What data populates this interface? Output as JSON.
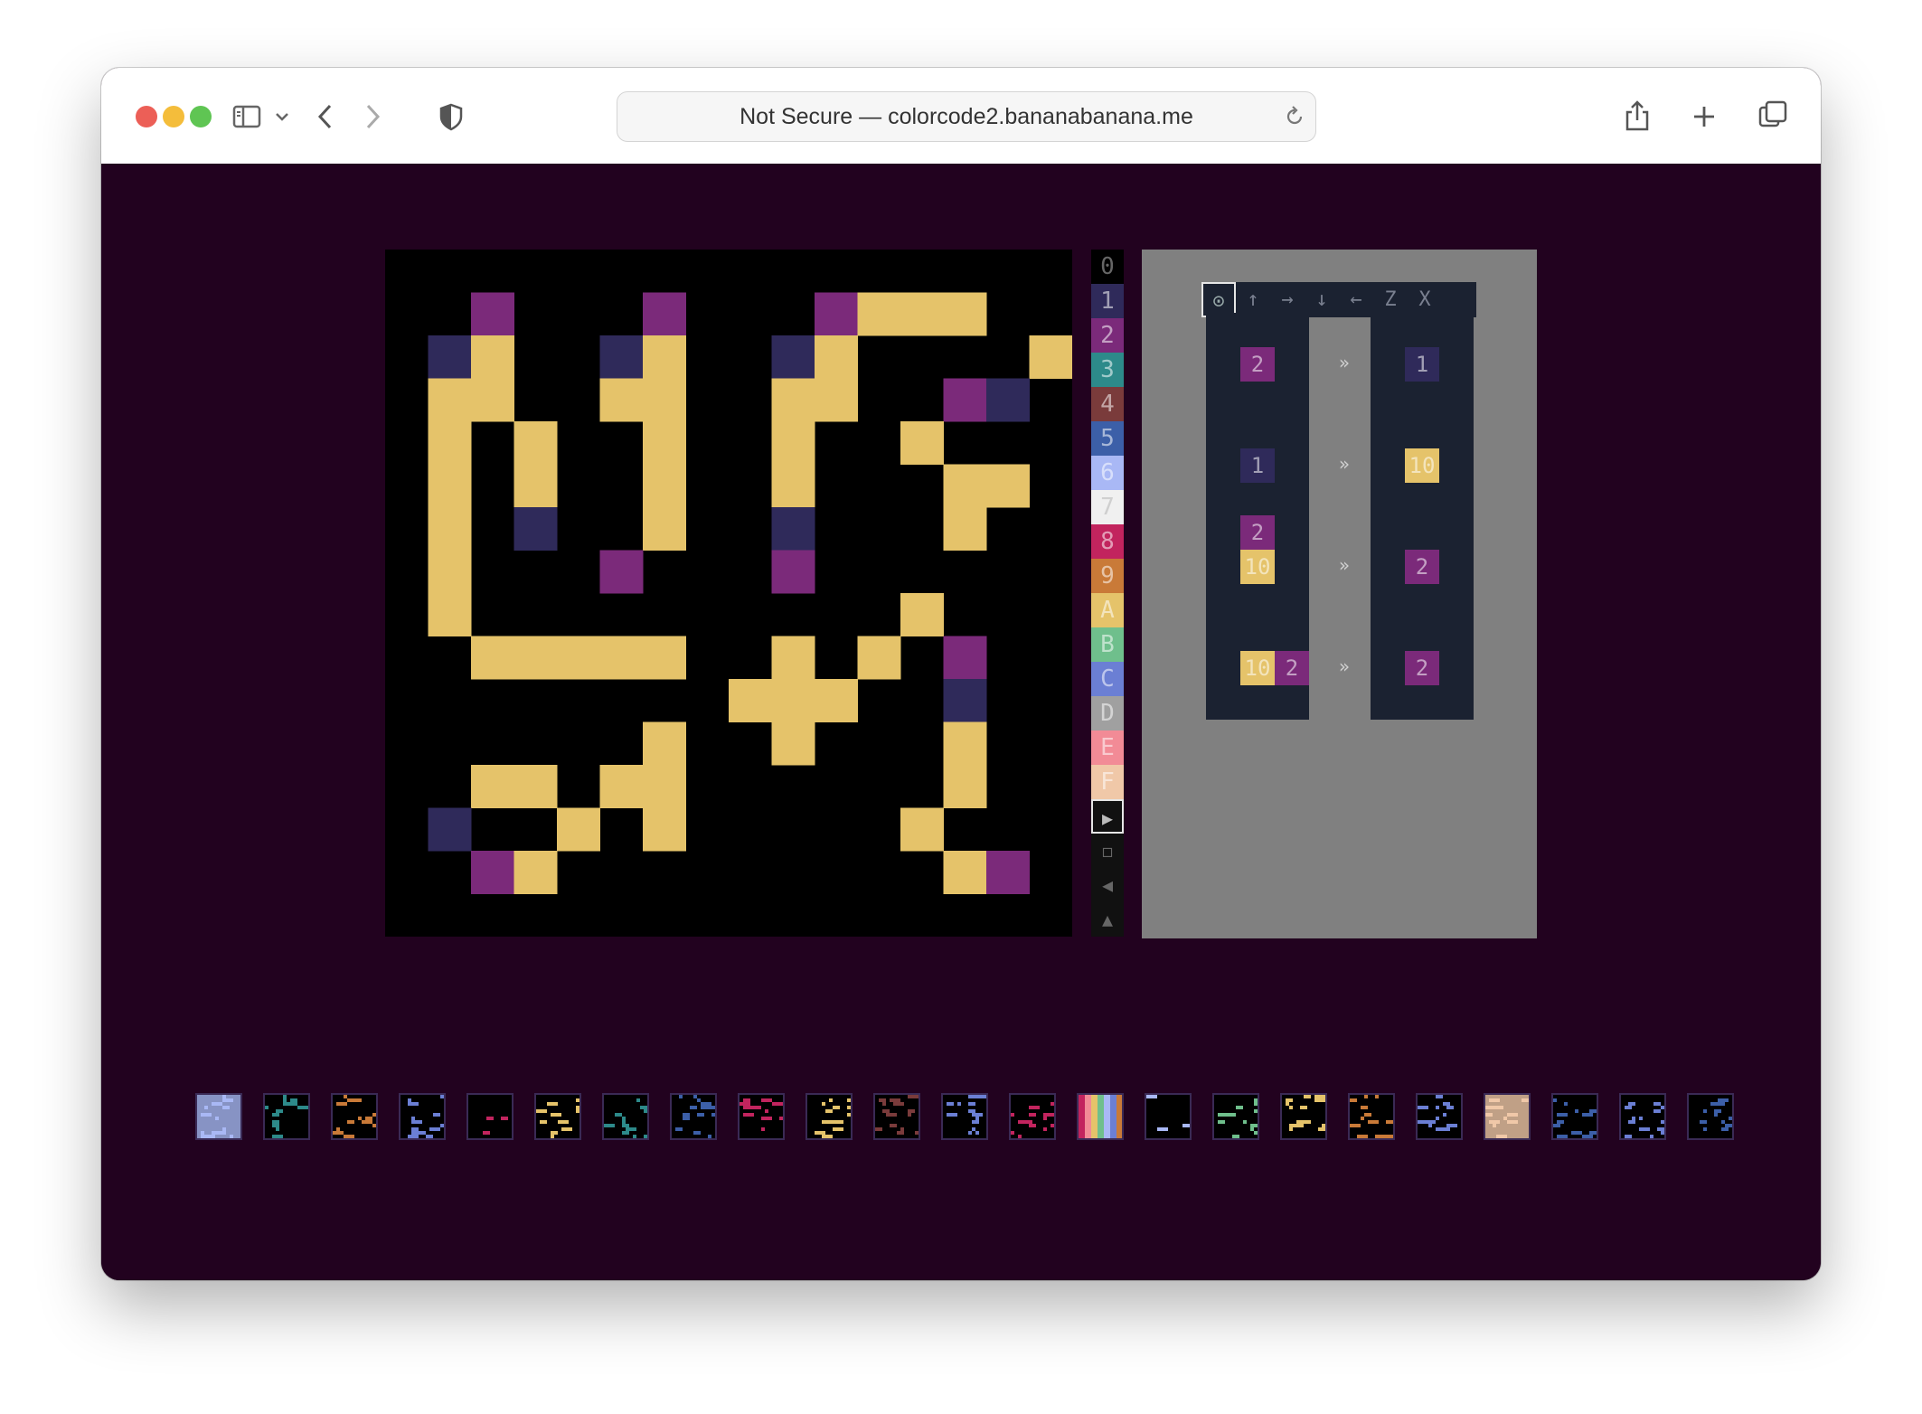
{
  "browser": {
    "url_text": "Not Secure — colorcode2.bananabanana.me"
  },
  "palette": {
    "labels": [
      "0",
      "1",
      "2",
      "3",
      "4",
      "5",
      "6",
      "7",
      "8",
      "9",
      "A",
      "B",
      "C",
      "D",
      "E",
      "F"
    ],
    "colors": [
      "#000000",
      "#2f2a5a",
      "#7b2a7a",
      "#2d8a8a",
      "#7a3b3b",
      "#3c5fa8",
      "#a9b8f5",
      "#f0f0f0",
      "#c2245e",
      "#c97a38",
      "#e5c36a",
      "#6fbf8c",
      "#6b7fd4",
      "#a0a0a0",
      "#f28b96",
      "#f0c8a8"
    ],
    "tools": [
      "▶",
      "◻",
      "◀",
      "▲"
    ]
  },
  "colors": {
    "yellow": "#e5c36a",
    "purple": "#7b2a7a",
    "navy": "#2f2a5a",
    "page_bg": "#22021f",
    "rules_bg": "#808080",
    "rule_box": "#1b2231"
  },
  "rules_toolbar": [
    "⊙",
    "↑",
    "→",
    "↓",
    "←",
    "Z",
    "X"
  ],
  "rules": [
    {
      "lhs": [
        "2"
      ],
      "rhs": [
        "1"
      ]
    },
    {
      "lhs": [
        "1"
      ],
      "rhs": [
        "10"
      ]
    },
    {
      "lhs": [
        "2",
        "10"
      ],
      "rhs": [
        "2"
      ]
    },
    {
      "lhs": [
        "10",
        "2"
      ],
      "rhs": [
        "2"
      ]
    }
  ],
  "rule_arrow": "»",
  "board_grid": [
    "..................",
    "..P...P...PYYY....",
    ".NY..NY..NY....Y..",
    ".YY..YY..YY..PN...",
    ".Y.Y..Y..Y..Y.....",
    ".Y.Y..Y..Y...YY...",
    ".Y.N..Y..N...Y..Y.",
    ".Y...P...P......N.",
    ".Y..........Y...P.",
    "..YYYYY..Y.Y.P..Y.",
    "........YYY..N..Y.",
    "......Y..Y...Y..Y.",
    "..YY.YY......Y..Y.",
    ".N..Y.Y.....Y...N.",
    "..PY.........YP...",
    ".................."
  ],
  "levels": [
    "level-01",
    "level-02",
    "level-03",
    "level-04",
    "level-05",
    "level-06",
    "level-07",
    "level-08",
    "level-09",
    "level-10",
    "level-11",
    "level-12",
    "level-13",
    "level-14",
    "level-15",
    "level-16",
    "level-17",
    "level-18",
    "level-19",
    "level-20",
    "level-21",
    "level-22",
    "level-23"
  ],
  "videos": [
    "video-1",
    "video-2",
    "video-3"
  ]
}
